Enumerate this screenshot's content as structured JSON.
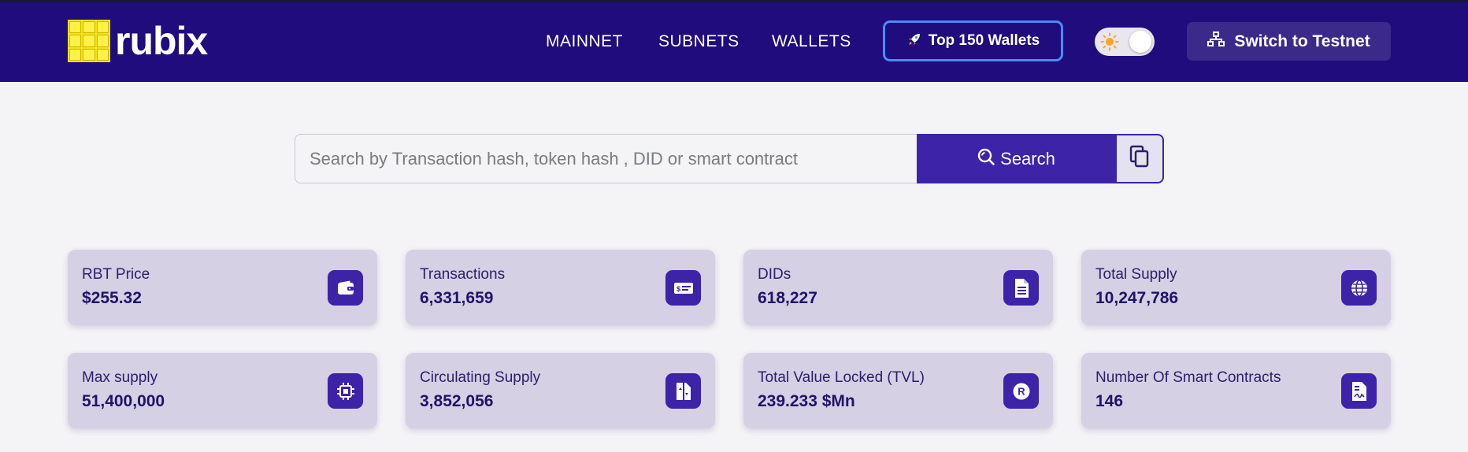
{
  "brand": {
    "name": "rubix"
  },
  "nav": {
    "items": [
      {
        "label": "MAINNET"
      },
      {
        "label": "SUBNETS"
      },
      {
        "label": "WALLETS"
      }
    ],
    "top_wallets_label": "Top 150 Wallets",
    "theme_toggle": {
      "mode": "light",
      "icon": "sun-icon"
    },
    "switch_label": "Switch to Testnet"
  },
  "search": {
    "placeholder": "Search by Transaction hash, token hash , DID or smart contract",
    "value": "",
    "button_label": "Search"
  },
  "stats": [
    {
      "label": "RBT Price",
      "value": "$255.32",
      "icon": "wallet-icon"
    },
    {
      "label": "Transactions",
      "value": "6,331,659",
      "icon": "money-bill-icon"
    },
    {
      "label": "DIDs",
      "value": "618,227",
      "icon": "document-icon"
    },
    {
      "label": "Total Supply",
      "value": "10,247,786",
      "icon": "globe-icon"
    },
    {
      "label": "Max supply",
      "value": "51,400,000",
      "icon": "chip-icon"
    },
    {
      "label": "Circulating Supply",
      "value": "3,852,056",
      "icon": "file-transfer-icon"
    },
    {
      "label": "Total Value Locked (TVL)",
      "value": "239.233 $Mn",
      "icon": "r-coin-icon"
    },
    {
      "label": "Number Of Smart Contracts",
      "value": "146",
      "icon": "contract-icon"
    }
  ],
  "colors": {
    "header_bg": "#200c7c",
    "accent": "#3c23a8",
    "card_bg": "#d5d0e4",
    "page_bg": "#f4f4f6",
    "highlight_border": "#4b8cf5",
    "logo_yellow": "#f6e316"
  }
}
